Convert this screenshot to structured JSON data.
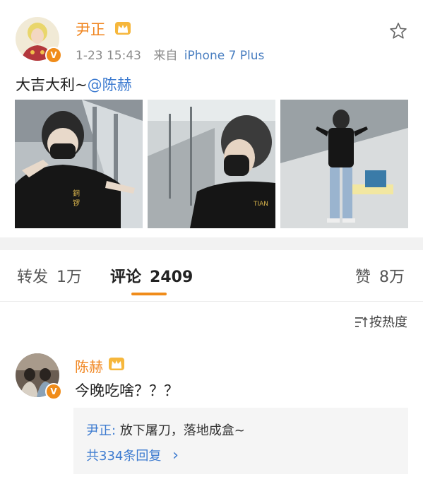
{
  "post": {
    "author": "尹正",
    "time": "1-23 15:43",
    "source_prefix": "来自",
    "source": "iPhone 7 Plus",
    "text": "大吉大利~",
    "mention": "@陈赫",
    "verified_badge": "V"
  },
  "tabs": {
    "repost_label": "转发",
    "repost_count": "1万",
    "comment_label": "评论",
    "comment_count": "2409",
    "like_label": "赞",
    "like_count": "8万"
  },
  "sort": {
    "label": "按热度"
  },
  "comment": {
    "author": "陈赫",
    "text": "今晚吃啥？？？",
    "verified_badge": "V",
    "reply_author": "尹正:",
    "reply_text": "放下屠刀，落地成盒~",
    "reply_count": "共334条回复",
    "reply_chevron": "›"
  },
  "icons": {
    "favorite": "star-icon",
    "crown": "crown-icon",
    "sort": "sort-icon",
    "chevron": "chevron-right-icon"
  },
  "colors": {
    "accent": "#f08c1a",
    "name": "#f0851f",
    "link": "#3d7bd0",
    "muted": "#8a8a8a"
  }
}
